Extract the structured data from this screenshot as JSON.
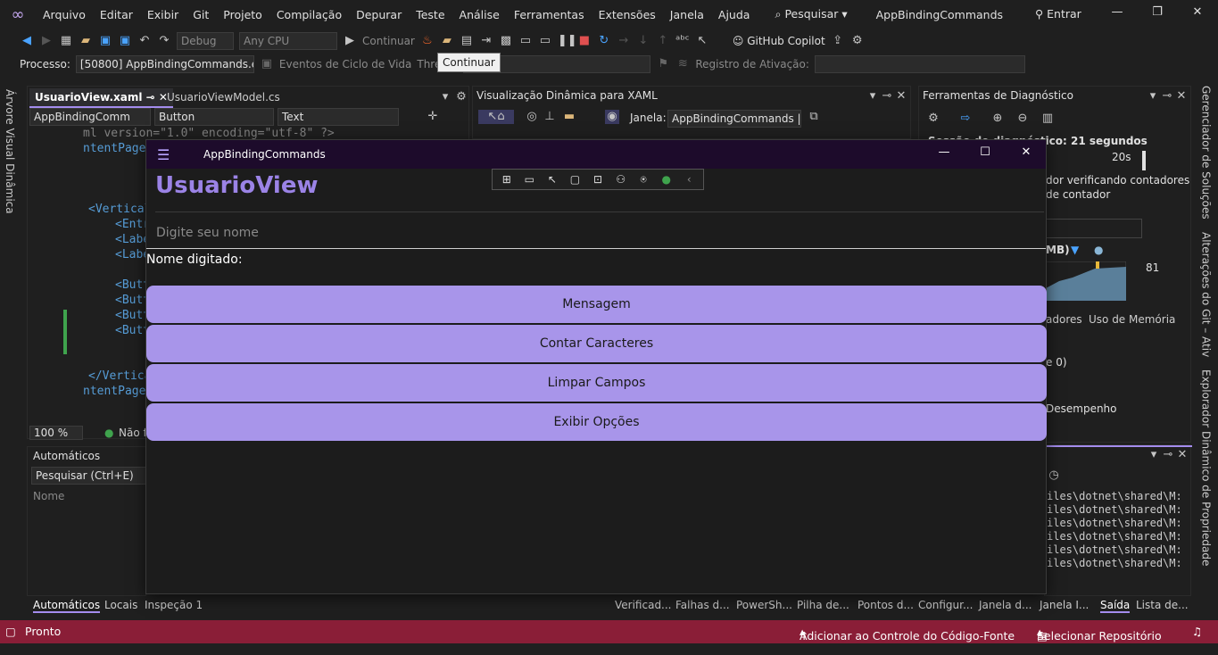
{
  "menu": {
    "items": [
      "Arquivo",
      "Editar",
      "Exibir",
      "Git",
      "Projeto",
      "Compilação",
      "Depurar",
      "Teste",
      "Análise",
      "Ferramentas",
      "Extensões",
      "Janela",
      "Ajuda"
    ],
    "search_label": "Pesquisar",
    "app_title": "AppBindingCommands",
    "signin_label": "Entrar"
  },
  "toolbar": {
    "config": "Debug",
    "platform": "Any CPU",
    "continue_label": "Continuar",
    "copilot_label": "GitHub Copilot"
  },
  "procbar": {
    "process_label": "Processo:",
    "process_value": "[50800] AppBindingCommands.ex",
    "lifecycle_label": "Eventos de Ciclo de Vida",
    "thread_label": "Thread",
    "activation_label": "Registro de Ativação:",
    "tooltip": "Continuar"
  },
  "leftrail": {
    "label": "Árvore Visual Dinâmica"
  },
  "rightrail": {
    "labels": [
      "Gerenciador de Soluções",
      "Alterações do Git – Ativ",
      "Explorador Dinâmico de Propriedade"
    ]
  },
  "editor": {
    "tabs": [
      "UsuarioView.xaml",
      "UsuarioViewModel.cs"
    ],
    "nav": [
      "AppBindingComm",
      "Button",
      "Text"
    ],
    "lines": [
      "ml version=\"1.0\" encoding=\"utf-8\" ?>",
      "ntentPage",
      "<Vertical",
      "<Entr",
      "<Labe",
      "<Labe",
      "<Butt",
      "<Butt",
      "<Butt",
      "<Butt",
      "</Vertical",
      "ntentPage"
    ],
    "zoom": "100 %",
    "status": "Não fo"
  },
  "xamlpane": {
    "title": "Visualização Dinâmica para XAML",
    "window_label": "Janela:",
    "window_value": "AppBindingCommands |"
  },
  "diagpane": {
    "title": "Ferramentas de Diagnóstico",
    "session": "Sessão de diagnóstico: 21 segundos",
    "tick": "20s",
    "counter_text_1": "dor verificando contadores",
    "counter_text_2": "de contador",
    "mem_label": "MB)",
    "mem_value": "81",
    "tab_a": "adores",
    "tab_b": "Uso de Memória",
    "row1": "e 0)",
    "row2": "Desempenho"
  },
  "autos": {
    "title": "Automáticos",
    "search": "Pesquisar (Ctrl+E)",
    "col_name": "Nome"
  },
  "output": {
    "lines": [
      "iles\\dotnet\\shared\\M:",
      "iles\\dotnet\\shared\\M:",
      "iles\\dotnet\\shared\\M:",
      "iles\\dotnet\\shared\\M:",
      "iles\\dotnet\\shared\\M:",
      "iles\\dotnet\\shared\\M:"
    ]
  },
  "bottom_tabs_left": [
    "Automáticos",
    "Locais",
    "Inspeção 1"
  ],
  "bottom_tabs_right": [
    "Verificad...",
    "Falhas d...",
    "PowerSh...",
    "Pilha de...",
    "Pontos d...",
    "Configur...",
    "Janela d...",
    "Janela I...",
    "Saída",
    "Lista de..."
  ],
  "maui": {
    "window_title": "AppBindingCommands",
    "page_title": "UsuarioView",
    "input_placeholder": "Digite seu nome",
    "label_text": "Nome digitado:",
    "buttons": [
      "Mensagem",
      "Contar Caracteres",
      "Limpar Campos",
      "Exibir Opções"
    ]
  },
  "statusbar": {
    "ready": "Pronto",
    "source_control": "Adicionar ao Controle do Código-Fonte",
    "repo": "Selecionar Repositório"
  },
  "colors": {
    "accent": "#a48cee",
    "maui_button": "#a895ea",
    "maui_header": "#9b83e6",
    "status_bar": "#8a1e37"
  }
}
